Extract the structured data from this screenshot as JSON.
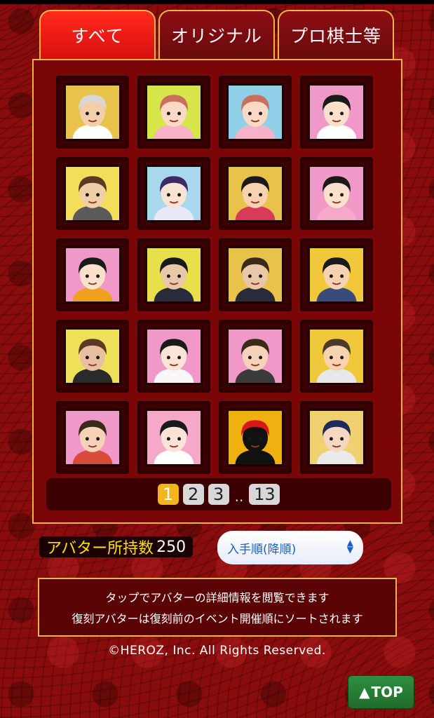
{
  "tabs": [
    {
      "label": "すべて",
      "active": true
    },
    {
      "label": "オリジナル",
      "active": false
    },
    {
      "label": "プロ棋士等",
      "active": false
    }
  ],
  "avatars": [
    {
      "name": "avatar-elderly-man-glasses",
      "bg": "#e8c24a",
      "skin": "#f2cfa8",
      "hair": "#d8d8d8",
      "shirt": "#ffffff"
    },
    {
      "name": "avatar-anime-cat-girl",
      "bg": "#d6e64a",
      "skin": "#fbd9c4",
      "hair": "#c7705c",
      "shirt": "#f6b2c8"
    },
    {
      "name": "avatar-anime-cat-girl-2",
      "bg": "#8fd0e8",
      "skin": "#fbd9c4",
      "hair": "#c7705c",
      "shirt": "#f6b2c8"
    },
    {
      "name": "avatar-girl-black-bob",
      "bg": "#f098c8",
      "skin": "#fbe0cc",
      "hair": "#1a1a1a",
      "shirt": "#ffffff"
    },
    {
      "name": "avatar-man-brown-hair",
      "bg": "#f3dd5a",
      "skin": "#f0cfa8",
      "hair": "#5a3a22",
      "shirt": "#5a5a5a"
    },
    {
      "name": "avatar-anime-bunny-girl",
      "bg": "#a8d8ee",
      "skin": "#fbe3d3",
      "hair": "#3b2a66",
      "shirt": "#e8e8f8"
    },
    {
      "name": "avatar-boy-black-hair",
      "bg": "#e8c24a",
      "skin": "#f6d2b0",
      "hair": "#1a1a1a",
      "shirt": "#d83a5a"
    },
    {
      "name": "avatar-girl-black-hair",
      "bg": "#f098c8",
      "skin": "#fbe0cc",
      "hair": "#1a1a1a",
      "shirt": "#f6a8c8"
    },
    {
      "name": "avatar-boy-cartoon",
      "bg": "#f098c8",
      "skin": "#fbe0cc",
      "hair": "#1a1a1a",
      "shirt": "#f0a020"
    },
    {
      "name": "avatar-man-glasses-suit",
      "bg": "#e8e04a",
      "skin": "#e8c8a8",
      "hair": "#1a1a1a",
      "shirt": "#2a2a3a"
    },
    {
      "name": "avatar-man-glasses-photo",
      "bg": "#e8c24a",
      "skin": "#e8c8a8",
      "hair": "#3a2a1a",
      "shirt": "#2a2a3a"
    },
    {
      "name": "avatar-young-man-cartoon",
      "bg": "#f0c83a",
      "skin": "#f6d2b0",
      "hair": "#1a1a1a",
      "shirt": "#3a4a7a"
    },
    {
      "name": "avatar-man-suit-smiling",
      "bg": "#eee058",
      "skin": "#e8bfa0",
      "hair": "#5a3a22",
      "shirt": "#2a2a2a"
    },
    {
      "name": "avatar-girl-flower-hair",
      "bg": "#f098c8",
      "skin": "#fbe3d8",
      "hair": "#1a1a1a",
      "shirt": "#f8f8f8"
    },
    {
      "name": "avatar-woman-short-hair",
      "bg": "#f098c8",
      "skin": "#f6d2b8",
      "hair": "#3a2a1a",
      "shirt": "#3a3a3a"
    },
    {
      "name": "avatar-man-glasses-cartoon",
      "bg": "#f0c83a",
      "skin": "#f6d2b0",
      "hair": "#4a3a2a",
      "shirt": "#e8e8e8"
    },
    {
      "name": "avatar-woman-bob",
      "bg": "#f098c8",
      "skin": "#f6d2b8",
      "hair": "#3a2a1a",
      "shirt": "#d84a3a"
    },
    {
      "name": "avatar-woman-sketch",
      "bg": "#f6a8c8",
      "skin": "#fbe3d8",
      "hair": "#1a1a1a",
      "shirt": "#ffffff"
    },
    {
      "name": "avatar-silhouette-2024-cap",
      "bg": "#f0b010",
      "skin": "#111111",
      "hair": "#d81818",
      "shirt": "#111111"
    },
    {
      "name": "avatar-anime-man-blue-hair",
      "bg": "#f0d070",
      "skin": "#f6d8c0",
      "hair": "#1e2a5a",
      "shirt": "#eaeaea"
    }
  ],
  "pager": {
    "pages": [
      "1",
      "2",
      "3"
    ],
    "ellipsis": "..",
    "last": "13"
  },
  "count": {
    "label": "アバター所持数",
    "value": "250"
  },
  "sort": {
    "selected": "入手順(降順)"
  },
  "info": {
    "line1": "タップでアバターの詳細情報を閲覧できます",
    "line2": "復刻アバターは復刻前のイベント開催順にソートされます"
  },
  "copyright": "©HEROZ, Inc. All Rights Reserved.",
  "top_button": {
    "arrow": "▲",
    "label": "TOP"
  },
  "colors": {
    "accent": "#f2b51c",
    "border_gold": "#e8b54a",
    "tab_active": "#ff2a1c"
  }
}
